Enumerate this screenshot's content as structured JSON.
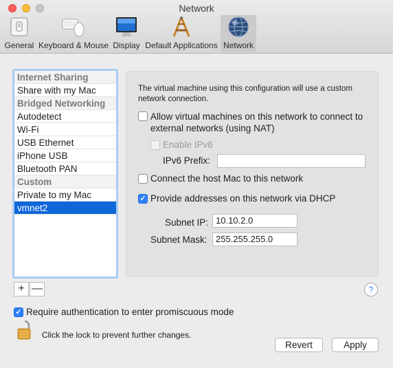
{
  "window": {
    "title": "Network"
  },
  "toolbar": {
    "items": [
      {
        "label": "General",
        "icon": "general-icon"
      },
      {
        "label": "Keyboard & Mouse",
        "icon": "keyboard-mouse-icon"
      },
      {
        "label": "Display",
        "icon": "display-icon"
      },
      {
        "label": "Default Applications",
        "icon": "default-applications-icon"
      },
      {
        "label": "Network",
        "icon": "network-globe-icon",
        "selected": true
      }
    ]
  },
  "sidebar": {
    "items": [
      {
        "label": "Internet Sharing",
        "type": "header"
      },
      {
        "label": "Share with my Mac",
        "type": "item"
      },
      {
        "label": "Bridged Networking",
        "type": "header"
      },
      {
        "label": "Autodetect",
        "type": "item"
      },
      {
        "label": "Wi-Fi",
        "type": "item"
      },
      {
        "label": "USB Ethernet",
        "type": "item"
      },
      {
        "label": "iPhone USB",
        "type": "item"
      },
      {
        "label": "Bluetooth PAN",
        "type": "item"
      },
      {
        "label": "Custom",
        "type": "header"
      },
      {
        "label": "Private to my Mac",
        "type": "item"
      },
      {
        "label": "vmnet2",
        "type": "item",
        "selected": true
      }
    ],
    "add_label": "+",
    "remove_label": "—"
  },
  "panel": {
    "description": "The virtual machine using this configuration will use a custom network connection.",
    "nat_label": "Allow virtual machines on this network to connect to external networks (using NAT)",
    "nat_checked": false,
    "ipv6_label": "Enable IPv6",
    "ipv6_checked": false,
    "ipv6_enabled": false,
    "ipv6_prefix_label": "IPv6 Prefix:",
    "ipv6_prefix_value": "",
    "host_label": "Connect the host Mac to this network",
    "host_checked": false,
    "dhcp_label": "Provide addresses on this network via DHCP",
    "dhcp_checked": true,
    "subnet_ip_label": "Subnet IP:",
    "subnet_ip_value": "10.10.2.0",
    "subnet_mask_label": "Subnet Mask:",
    "subnet_mask_value": "255.255.255.0"
  },
  "help_label": "?",
  "footer": {
    "promiscuous_label": "Require authentication to enter promiscuous mode",
    "promiscuous_checked": true,
    "lock_text": "Click the lock to prevent further changes.",
    "revert_label": "Revert",
    "apply_label": "Apply"
  },
  "colors": {
    "accent": "#2d7ff9",
    "selection": "#0f66d9",
    "focus_ring": "#a9ccf3"
  }
}
